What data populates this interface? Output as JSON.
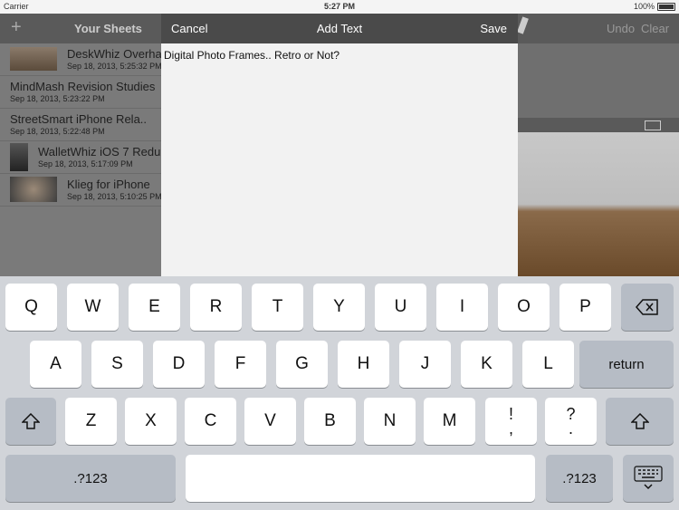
{
  "status": {
    "carrier": "Carrier",
    "time": "5:27 PM",
    "battery": "100%"
  },
  "sidebar": {
    "title": "Your Sheets",
    "add": "+",
    "sheets": [
      {
        "name": "DeskWhiz Overha",
        "date": "Sep 18, 2013, 5:25:32 PM",
        "thumb": "wide"
      },
      {
        "name": "MindMash Revision Studies",
        "date": "Sep 18, 2013, 5:23:22 PM",
        "thumb": "none"
      },
      {
        "name": "StreetSmart iPhone Rela..",
        "date": "Sep 18, 2013, 5:22:48 PM",
        "thumb": "none"
      },
      {
        "name": "WalletWhiz iOS 7 Redu",
        "date": "Sep 18, 2013, 5:17:09 PM",
        "thumb": "tall"
      },
      {
        "name": "Klieg for iPhone",
        "date": "Sep 18, 2013, 5:10:25 PM",
        "thumb": "square"
      }
    ]
  },
  "right_toolbar": {
    "undo": "Undo",
    "clear": "Clear"
  },
  "modal": {
    "cancel": "Cancel",
    "title": "Add Text",
    "save": "Save",
    "text": "Digital Photo Frames.. Retro or Not?"
  },
  "keyboard": {
    "row1": [
      "Q",
      "W",
      "E",
      "R",
      "T",
      "Y",
      "U",
      "I",
      "O",
      "P"
    ],
    "row2": [
      "A",
      "S",
      "D",
      "F",
      "G",
      "H",
      "J",
      "K",
      "L"
    ],
    "return": "return",
    "row3": [
      "Z",
      "X",
      "C",
      "V",
      "B",
      "N",
      "M"
    ],
    "punct1": [
      "!",
      ","
    ],
    "punct2": [
      "?",
      "."
    ],
    "numbers": ".?123"
  }
}
